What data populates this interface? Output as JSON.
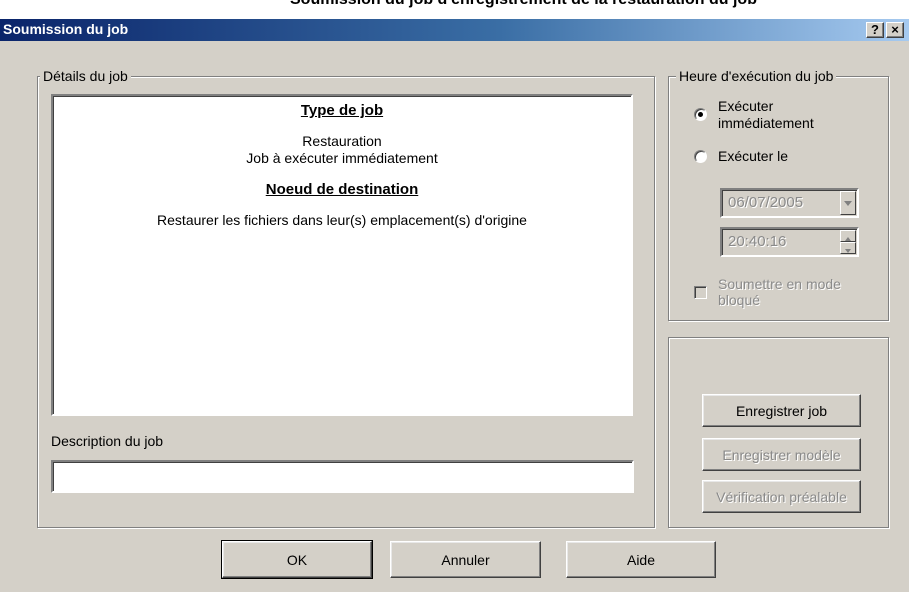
{
  "window": {
    "clipped_heading": "Soumission du job d'enregistrement de la restauration du job",
    "title": "Soumission du job",
    "help_button": "?",
    "close_button": "×"
  },
  "details": {
    "group_label": "Détails du job",
    "job_type_heading": "Type de job",
    "job_type_line1": "Restauration",
    "job_type_line2": "Job à exécuter immédiatement",
    "destination_heading": "Noeud de destination",
    "destination_text": "Restaurer les fichiers dans leur(s) emplacement(s) d'origine",
    "description_label": "Description du job",
    "description_value": ""
  },
  "schedule": {
    "group_label": "Heure d'exécution du job",
    "run_now_label": "Exécuter immédiatement",
    "run_now_selected": true,
    "run_at_label": "Exécuter le",
    "date_value": "06/07/2005",
    "time_value": "20:40:16",
    "hold_label": "Soumettre en mode bloqué",
    "hold_checked": false
  },
  "actions": {
    "save_job": "Enregistrer job",
    "save_template": "Enregistrer modèle",
    "preflight_check": "Vérification préalable"
  },
  "footer": {
    "ok": "OK",
    "cancel": "Annuler",
    "help": "Aide"
  }
}
